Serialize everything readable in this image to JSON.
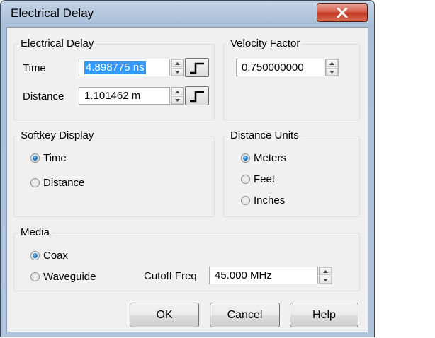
{
  "window": {
    "title": "Electrical Delay",
    "close_icon": "close-x-icon"
  },
  "electrical_delay": {
    "group_title": "Electrical Delay",
    "time_label": "Time",
    "time_value": "4.898775 ns",
    "distance_label": "Distance",
    "distance_value": "1.101462 m"
  },
  "velocity_factor": {
    "group_title": "Velocity Factor",
    "value": "0.750000000"
  },
  "softkey_display": {
    "group_title": "Softkey Display",
    "options": [
      {
        "label": "Time",
        "selected": true
      },
      {
        "label": "Distance",
        "selected": false
      }
    ]
  },
  "distance_units": {
    "group_title": "Distance Units",
    "options": [
      {
        "label": "Meters",
        "selected": true
      },
      {
        "label": "Feet",
        "selected": false
      },
      {
        "label": "Inches",
        "selected": false
      }
    ]
  },
  "media": {
    "group_title": "Media",
    "options": [
      {
        "label": "Coax",
        "selected": true
      },
      {
        "label": "Waveguide",
        "selected": false
      }
    ],
    "cutoff_label": "Cutoff Freq",
    "cutoff_value": "45.000 MHz"
  },
  "buttons": {
    "ok": "OK",
    "cancel": "Cancel",
    "help": "Help"
  }
}
